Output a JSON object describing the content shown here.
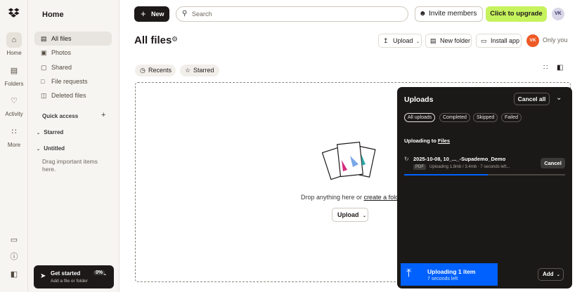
{
  "rail": {
    "items": [
      {
        "label": "Home",
        "icon": "home-icon"
      },
      {
        "label": "Folders",
        "icon": "folder-icon"
      },
      {
        "label": "Activity",
        "icon": "bell-icon"
      },
      {
        "label": "More",
        "icon": "grid-icon"
      }
    ]
  },
  "sidebar": {
    "title": "Home",
    "nav": [
      {
        "label": "All files",
        "icon": "all-files-icon"
      },
      {
        "label": "Photos",
        "icon": "photo-icon"
      },
      {
        "label": "Shared",
        "icon": "shared-icon"
      },
      {
        "label": "File requests",
        "icon": "file-request-icon"
      },
      {
        "label": "Deleted files",
        "icon": "trash-icon"
      }
    ],
    "quick_access": "Quick access",
    "starred": "Starred",
    "untitled": "Untitled",
    "drag_hint": "Drag important items here.",
    "get_started": {
      "title": "Get started",
      "percent": "0%",
      "subtitle": "Add a file or folder"
    }
  },
  "topbar": {
    "new_label": "New",
    "search_placeholder": "Search",
    "invite_label": "Invite members",
    "upgrade_label": "Click to upgrade",
    "avatar_initials": "VK"
  },
  "main": {
    "title": "All files",
    "toolbar": {
      "upload": "Upload",
      "new_folder": "New folder",
      "install_app": "Install app",
      "avatar_initials": "VK",
      "sharing": "Only you"
    },
    "chips": [
      "Recents",
      "Starred"
    ],
    "drop_text": "Drop anything here or ",
    "drop_link": "create a folder",
    "upload_button": "Upload"
  },
  "uploads_panel": {
    "title": "Uploads",
    "cancel_all": "Cancel all",
    "tabs": [
      "All uploads",
      "Completed",
      "Skipped",
      "Failed"
    ],
    "uploading_to_prefix": "Uploading to ",
    "uploading_to_link": "Files",
    "file": {
      "name": "2025-10-08, 10_..._-Supademo_Demo",
      "type": "PDF",
      "status": "Uploading 1.8mb / 3.4mb · 7 seconds left...",
      "cancel": "Cancel",
      "progress": 0.52
    },
    "bar": {
      "title": "Uploading 1 item",
      "subtitle": "7 seconds left"
    },
    "add_label": "Add"
  },
  "colors": {
    "accent": "#0061fe",
    "upgrade": "#c6f25e",
    "dark": "#1e1919",
    "avatar_orange": "#ee5a26"
  }
}
